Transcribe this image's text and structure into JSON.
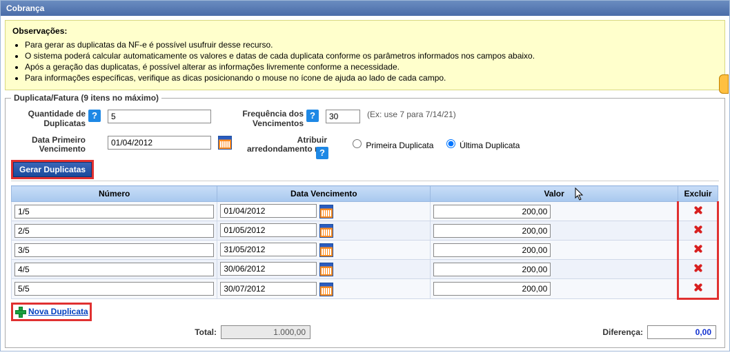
{
  "title": "Cobrança",
  "obs": {
    "heading": "Observações:",
    "items": [
      "Para gerar as duplicatas da NF-e é possível usufruir desse recurso.",
      "O sistema poderá calcular automaticamente os valores e datas de cada duplicata conforme os parâmetros informados nos campos abaixo.",
      "Após a geração das duplicatas, é possível alterar as informações livremente conforme a necessidade.",
      "Para informações específicas, verifique as dicas posicionando o mouse no ícone de ajuda ao lado de cada campo."
    ]
  },
  "fieldset_legend": "Duplicata/Fatura (9 itens no máximo)",
  "form": {
    "qtd_label": "Quantidade de\nDuplicatas",
    "qtd_value": "5",
    "freq_label": "Frequência dos\nVencimentos",
    "freq_value": "30",
    "freq_hint": "(Ex: use 7 para 7/14/21)",
    "data_prim_label": "Data Primeiro\nVencimento",
    "data_prim_value": "01/04/2012",
    "arred_label": "Atribuir\narredondamento na:",
    "radio_prim": "Primeira Duplicata",
    "radio_ult": "Última Duplicata",
    "radio_selected": "ult"
  },
  "btn_gerar": "Gerar Duplicatas",
  "table": {
    "headers": {
      "numero": "Número",
      "data": "Data Vencimento",
      "valor": "Valor",
      "excluir": "Excluir"
    },
    "rows": [
      {
        "numero": "1/5",
        "data": "01/04/2012",
        "valor": "200,00"
      },
      {
        "numero": "2/5",
        "data": "01/05/2012",
        "valor": "200,00"
      },
      {
        "numero": "3/5",
        "data": "31/05/2012",
        "valor": "200,00"
      },
      {
        "numero": "4/5",
        "data": "30/06/2012",
        "valor": "200,00"
      },
      {
        "numero": "5/5",
        "data": "30/07/2012",
        "valor": "200,00"
      }
    ]
  },
  "nova_dup": "Nova Duplicata",
  "totals": {
    "total_label": "Total:",
    "total_value": "1.000,00",
    "diff_label": "Diferença:",
    "diff_value": "0,00"
  }
}
